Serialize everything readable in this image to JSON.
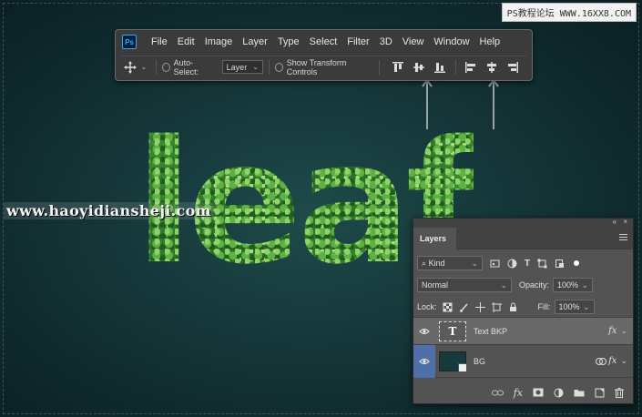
{
  "watermark": {
    "top_right": "PS教程论坛 WWW.16XX8.COM",
    "center_left": "www.haoyidiansheji.com"
  },
  "canvas": {
    "text": "leaf",
    "text_fill": "leaf-texture",
    "background_color": "#173a3c"
  },
  "photoshop": {
    "logo": "Ps",
    "menu": [
      "File",
      "Edit",
      "Image",
      "Layer",
      "Type",
      "Select",
      "Filter",
      "3D",
      "View",
      "Window",
      "Help"
    ],
    "options_bar": {
      "tool_icon": "move-tool-icon",
      "auto_select_label": "Auto-Select:",
      "auto_select_value": "Layer",
      "show_transform_label": "Show Transform Controls",
      "align_buttons": [
        "align-top-edges-icon",
        "align-vertical-centers-icon",
        "align-bottom-edges-icon",
        "align-left-edges-icon",
        "align-horizontal-centers-icon",
        "align-right-edges-icon"
      ],
      "highlighted_buttons": [
        "align-vertical-centers-icon",
        "align-horizontal-centers-icon"
      ]
    }
  },
  "layers_panel": {
    "tab_title": "Layers",
    "top_controls": [
      "«",
      "×"
    ],
    "filter_kind": "Kind",
    "blend_mode": "Normal",
    "opacity_label": "Opacity:",
    "opacity_value": "100%",
    "lock_label": "Lock:",
    "fill_label": "Fill:",
    "fill_value": "100%",
    "layers": [
      {
        "name": "Text BKP",
        "type": "text",
        "thumbnail": "T",
        "visible": true,
        "fx": "fx",
        "selected": true
      },
      {
        "name": "BG",
        "type": "smart-object",
        "visible": true,
        "fx": "fx",
        "selected": false
      }
    ],
    "bottom_icons": [
      "link-icon",
      "fx-icon",
      "mask-icon",
      "adjustment-icon",
      "folder-icon",
      "new-layer-icon",
      "trash-icon"
    ],
    "colors": {
      "panel": "#535353",
      "selected_row": "#686868",
      "eye_active": "#4f6fa8"
    }
  }
}
